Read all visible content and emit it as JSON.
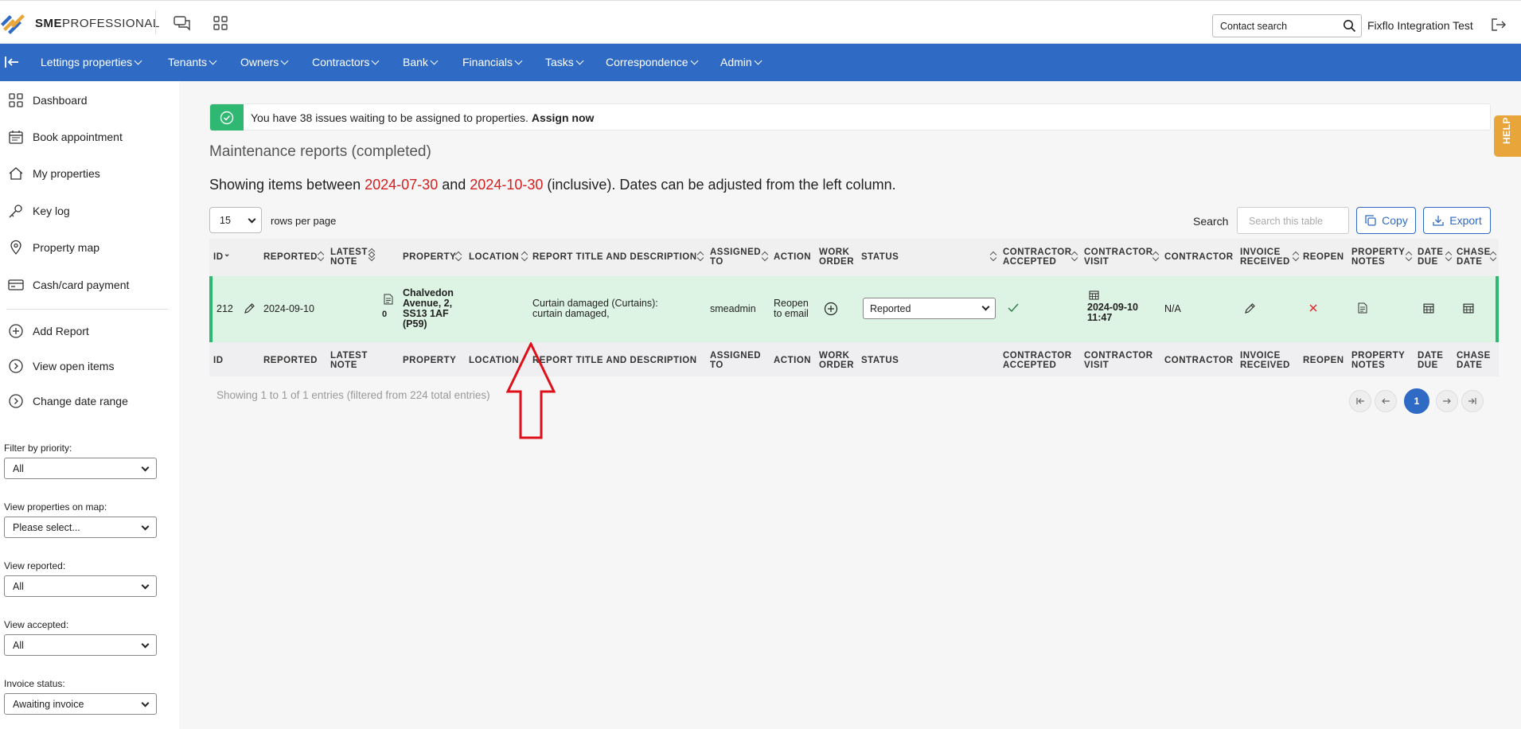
{
  "app": {
    "logo_bold": "SME",
    "logo_rest": "PROFESSIONAL",
    "contact_search_placeholder": "Contact search",
    "user_name": "Fixflo Integration Test"
  },
  "nav": {
    "items": [
      "Lettings properties",
      "Tenants",
      "Owners",
      "Contractors",
      "Bank",
      "Financials",
      "Tasks",
      "Correspondence",
      "Admin"
    ]
  },
  "sidebar": {
    "items": [
      "Dashboard",
      "Book appointment",
      "My properties",
      "Key log",
      "Property map",
      "Cash/card payment"
    ],
    "actions": [
      "Add Report",
      "View open items",
      "Change date range"
    ],
    "filters": [
      {
        "label": "Filter by priority:",
        "value": "All"
      },
      {
        "label": "View properties on map:",
        "value": "Please select..."
      },
      {
        "label": "View reported:",
        "value": "All"
      },
      {
        "label": "View accepted:",
        "value": "All"
      },
      {
        "label": "Invoice status:",
        "value": "Awaiting invoice"
      }
    ]
  },
  "alert": {
    "text": "You have 38 issues waiting to be assigned to properties.",
    "link": "Assign now"
  },
  "page": {
    "title": "Maintenance reports (completed)",
    "date_prefix": "Showing items between",
    "date_from": "2024-07-30",
    "date_and": "and",
    "date_to": "2024-10-30",
    "date_suffix": "(inclusive). Dates can be adjusted from the left column."
  },
  "controls": {
    "rows_value": "15",
    "rows_label": "rows per page",
    "search_label": "Search",
    "search_placeholder": "Search this table",
    "copy_label": "Copy",
    "export_label": "Export"
  },
  "table": {
    "headers": {
      "id": "ID",
      "reported": "REPORTED",
      "latest_note_1": "LATEST",
      "latest_note_2": "NOTE",
      "property": "PROPERTY",
      "location": "LOCATION",
      "report": "REPORT TITLE AND DESCRIPTION",
      "assigned_1": "ASSIGNED",
      "assigned_2": "TO",
      "action": "ACTION",
      "work_1": "WORK",
      "work_2": "ORDER",
      "status": "STATUS",
      "accepted_1": "CONTRACTOR",
      "accepted_2": "ACCEPTED",
      "visit_1": "CONTRACTOR",
      "visit_2": "VISIT",
      "contractor": "CONTRACTOR",
      "invoice_1": "INVOICE",
      "invoice_2": "RECEIVED",
      "reopen": "REOPEN",
      "notes_1": "PROPERTY",
      "notes_2": "NOTES",
      "due_1": "DATE",
      "due_2": "DUE",
      "chase_1": "CHASE",
      "chase_2": "DATE"
    },
    "row": {
      "id": "212",
      "reported": "2024-09-10",
      "latest_note_count": "0",
      "property_1": "Chalvedon",
      "property_2": "Avenue, 2,",
      "property_3": "SS13 1AF",
      "property_4": "(P59)",
      "report_1": "Curtain damaged (Curtains):",
      "report_2": "curtain damaged,",
      "assigned": "smeadmin",
      "action_1": "Reopen",
      "action_2": "to email",
      "status": "Reported",
      "visit_1": "2024-09-10",
      "visit_2": "11:47",
      "contractor": "N/A"
    }
  },
  "footer": {
    "entries_text": "Showing 1 to 1 of 1 entries (filtered from 224 total entries)",
    "current_page": "1"
  },
  "help_label": "HELP",
  "colors": {
    "nav_blue": "#2f6bc4",
    "success_green": "#2eb872",
    "row_highlight": "#ddf3e3",
    "date_red": "#d42020",
    "help_orange": "#e8a63a",
    "annotation_red": "#e0101a"
  }
}
